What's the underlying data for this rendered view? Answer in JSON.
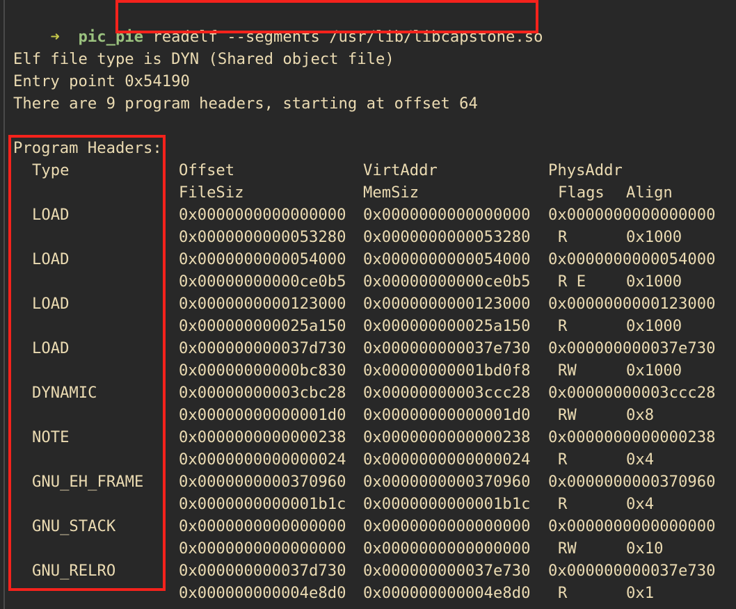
{
  "prompt": {
    "arrow": "➜",
    "directory": "pic_pie",
    "command": "readelf --segments /usr/lib/libcapstone.so"
  },
  "output": {
    "file_type_line": "Elf file type is DYN (Shared object file)",
    "entry_point_line": "Entry point 0x54190",
    "headers_count_line": "There are 9 program headers, starting at offset 64"
  },
  "program_headers": {
    "title": "Program Headers:",
    "columns_row1": {
      "type": "Type",
      "offset": "Offset",
      "virtaddr": "VirtAddr",
      "physaddr": "PhysAddr"
    },
    "columns_row2": {
      "filesiz": "FileSiz",
      "memsiz": "MemSiz",
      "flags": "Flags",
      "align": "Align"
    },
    "rows": [
      {
        "type": "LOAD",
        "offset": "0x0000000000000000",
        "virtaddr": "0x0000000000000000",
        "physaddr": "0x0000000000000000",
        "filesiz": "0x0000000000053280",
        "memsiz": "0x0000000000053280",
        "flags": "R",
        "align": "0x1000"
      },
      {
        "type": "LOAD",
        "offset": "0x0000000000054000",
        "virtaddr": "0x0000000000054000",
        "physaddr": "0x0000000000054000",
        "filesiz": "0x00000000000ce0b5",
        "memsiz": "0x00000000000ce0b5",
        "flags": "R E",
        "align": "0x1000"
      },
      {
        "type": "LOAD",
        "offset": "0x0000000000123000",
        "virtaddr": "0x0000000000123000",
        "physaddr": "0x0000000000123000",
        "filesiz": "0x000000000025a150",
        "memsiz": "0x000000000025a150",
        "flags": "R",
        "align": "0x1000"
      },
      {
        "type": "LOAD",
        "offset": "0x000000000037d730",
        "virtaddr": "0x000000000037e730",
        "physaddr": "0x000000000037e730",
        "filesiz": "0x00000000000bc830",
        "memsiz": "0x00000000001bd0f8",
        "flags": "RW",
        "align": "0x1000"
      },
      {
        "type": "DYNAMIC",
        "offset": "0x00000000003cbc28",
        "virtaddr": "0x00000000003ccc28",
        "physaddr": "0x00000000003ccc28",
        "filesiz": "0x00000000000001d0",
        "memsiz": "0x00000000000001d0",
        "flags": "RW",
        "align": "0x8"
      },
      {
        "type": "NOTE",
        "offset": "0x0000000000000238",
        "virtaddr": "0x0000000000000238",
        "physaddr": "0x0000000000000238",
        "filesiz": "0x0000000000000024",
        "memsiz": "0x0000000000000024",
        "flags": "R",
        "align": "0x4"
      },
      {
        "type": "GNU_EH_FRAME",
        "offset": "0x0000000000370960",
        "virtaddr": "0x0000000000370960",
        "physaddr": "0x0000000000370960",
        "filesiz": "0x0000000000001b1c",
        "memsiz": "0x0000000000001b1c",
        "flags": "R",
        "align": "0x4"
      },
      {
        "type": "GNU_STACK",
        "offset": "0x0000000000000000",
        "virtaddr": "0x0000000000000000",
        "physaddr": "0x0000000000000000",
        "filesiz": "0x0000000000000000",
        "memsiz": "0x0000000000000000",
        "flags": "RW",
        "align": "0x10"
      },
      {
        "type": "GNU_RELRO",
        "offset": "0x000000000037d730",
        "virtaddr": "0x000000000037e730",
        "physaddr": "0x000000000037e730",
        "filesiz": "0x000000000004e8d0",
        "memsiz": "0x000000000004e8d0",
        "flags": "R",
        "align": "0x1"
      }
    ]
  },
  "annotations": {
    "highlight_color": "#f4221c"
  }
}
